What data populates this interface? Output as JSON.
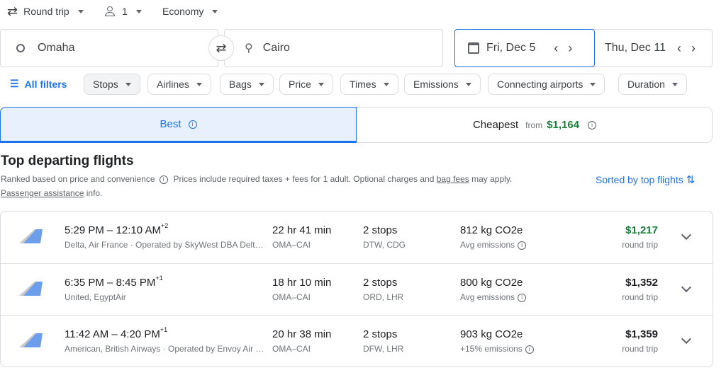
{
  "trip": {
    "type": "Round trip",
    "passengers": "1",
    "cabin": "Economy"
  },
  "search": {
    "origin": "Omaha",
    "destination": "Cairo",
    "depart": "Fri, Dec 5",
    "return": "Thu, Dec 11"
  },
  "filters": {
    "all": "All filters",
    "chips": [
      "Stops",
      "Airlines",
      "Bags",
      "Price",
      "Times",
      "Emissions",
      "Connecting airports",
      "Duration"
    ]
  },
  "tabs": {
    "best": "Best",
    "cheapest": "Cheapest",
    "from": "from",
    "cheapest_price": "$1,164"
  },
  "section": {
    "title": "Top departing flights",
    "ranked": "Ranked based on price and convenience",
    "prices_note": "Prices include required taxes + fees for 1 adult. Optional charges and",
    "bag_fees": "bag fees",
    "may_apply": "may apply.",
    "assistance": "Passenger assistance",
    "info": "info.",
    "sorted": "Sorted by top flights"
  },
  "flights": [
    {
      "depart": "5:29 PM",
      "arrive": "12:10 AM",
      "offset": "+2",
      "airlines": "Delta, Air France · Operated by SkyWest DBA Delt…",
      "duration": "22 hr 41 min",
      "route": "OMA–CAI",
      "stops": "2 stops",
      "via": "DTW, CDG",
      "co2": "812 kg CO2e",
      "emissions": "Avg emissions",
      "price": "$1,217",
      "price_color": "#188038",
      "trip": "round trip"
    },
    {
      "depart": "6:35 PM",
      "arrive": "8:45 PM",
      "offset": "+1",
      "airlines": "United, EgyptAir",
      "duration": "18 hr 10 min",
      "route": "OMA–CAI",
      "stops": "2 stops",
      "via": "ORD, LHR",
      "co2": "800 kg CO2e",
      "emissions": "Avg emissions",
      "price": "$1,352",
      "price_color": "#202124",
      "trip": "round trip"
    },
    {
      "depart": "11:42 AM",
      "arrive": "4:20 PM",
      "offset": "+1",
      "airlines": "American, British Airways · Operated by Envoy Air …",
      "duration": "20 hr 38 min",
      "route": "OMA–CAI",
      "stops": "2 stops",
      "via": "DFW, LHR",
      "co2": "903 kg CO2e",
      "emissions": "+15% emissions",
      "price": "$1,359",
      "price_color": "#202124",
      "trip": "round trip"
    }
  ]
}
